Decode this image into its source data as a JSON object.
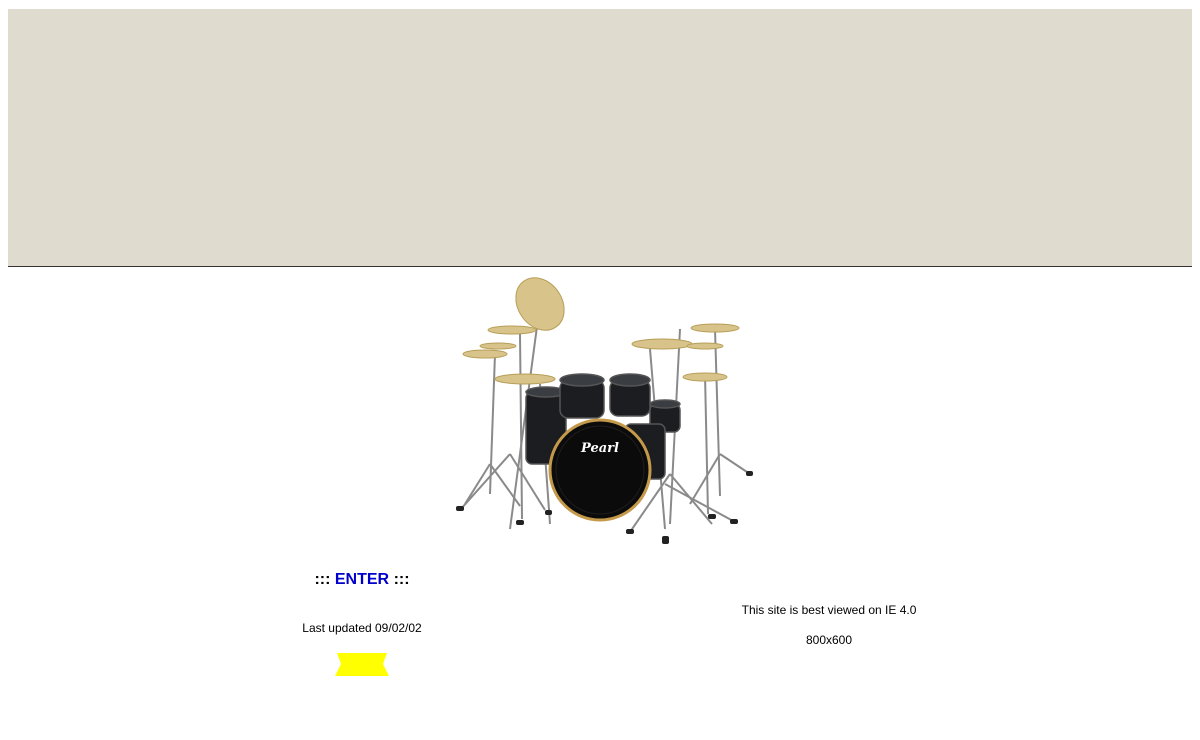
{
  "banner": {
    "color": "#dfdbcf"
  },
  "drum_image": {
    "brand": "Pearl"
  },
  "enter": {
    "prefix": ":::",
    "label": "ENTER",
    "suffix": ":::",
    "link_color": "#0000cc"
  },
  "updated": {
    "text": "Last updated 09/02/02"
  },
  "badge": {
    "color": "#ffff00"
  },
  "browser_note": {
    "line1": "This site is best viewed on IE 4.0",
    "line2": "800x600"
  }
}
